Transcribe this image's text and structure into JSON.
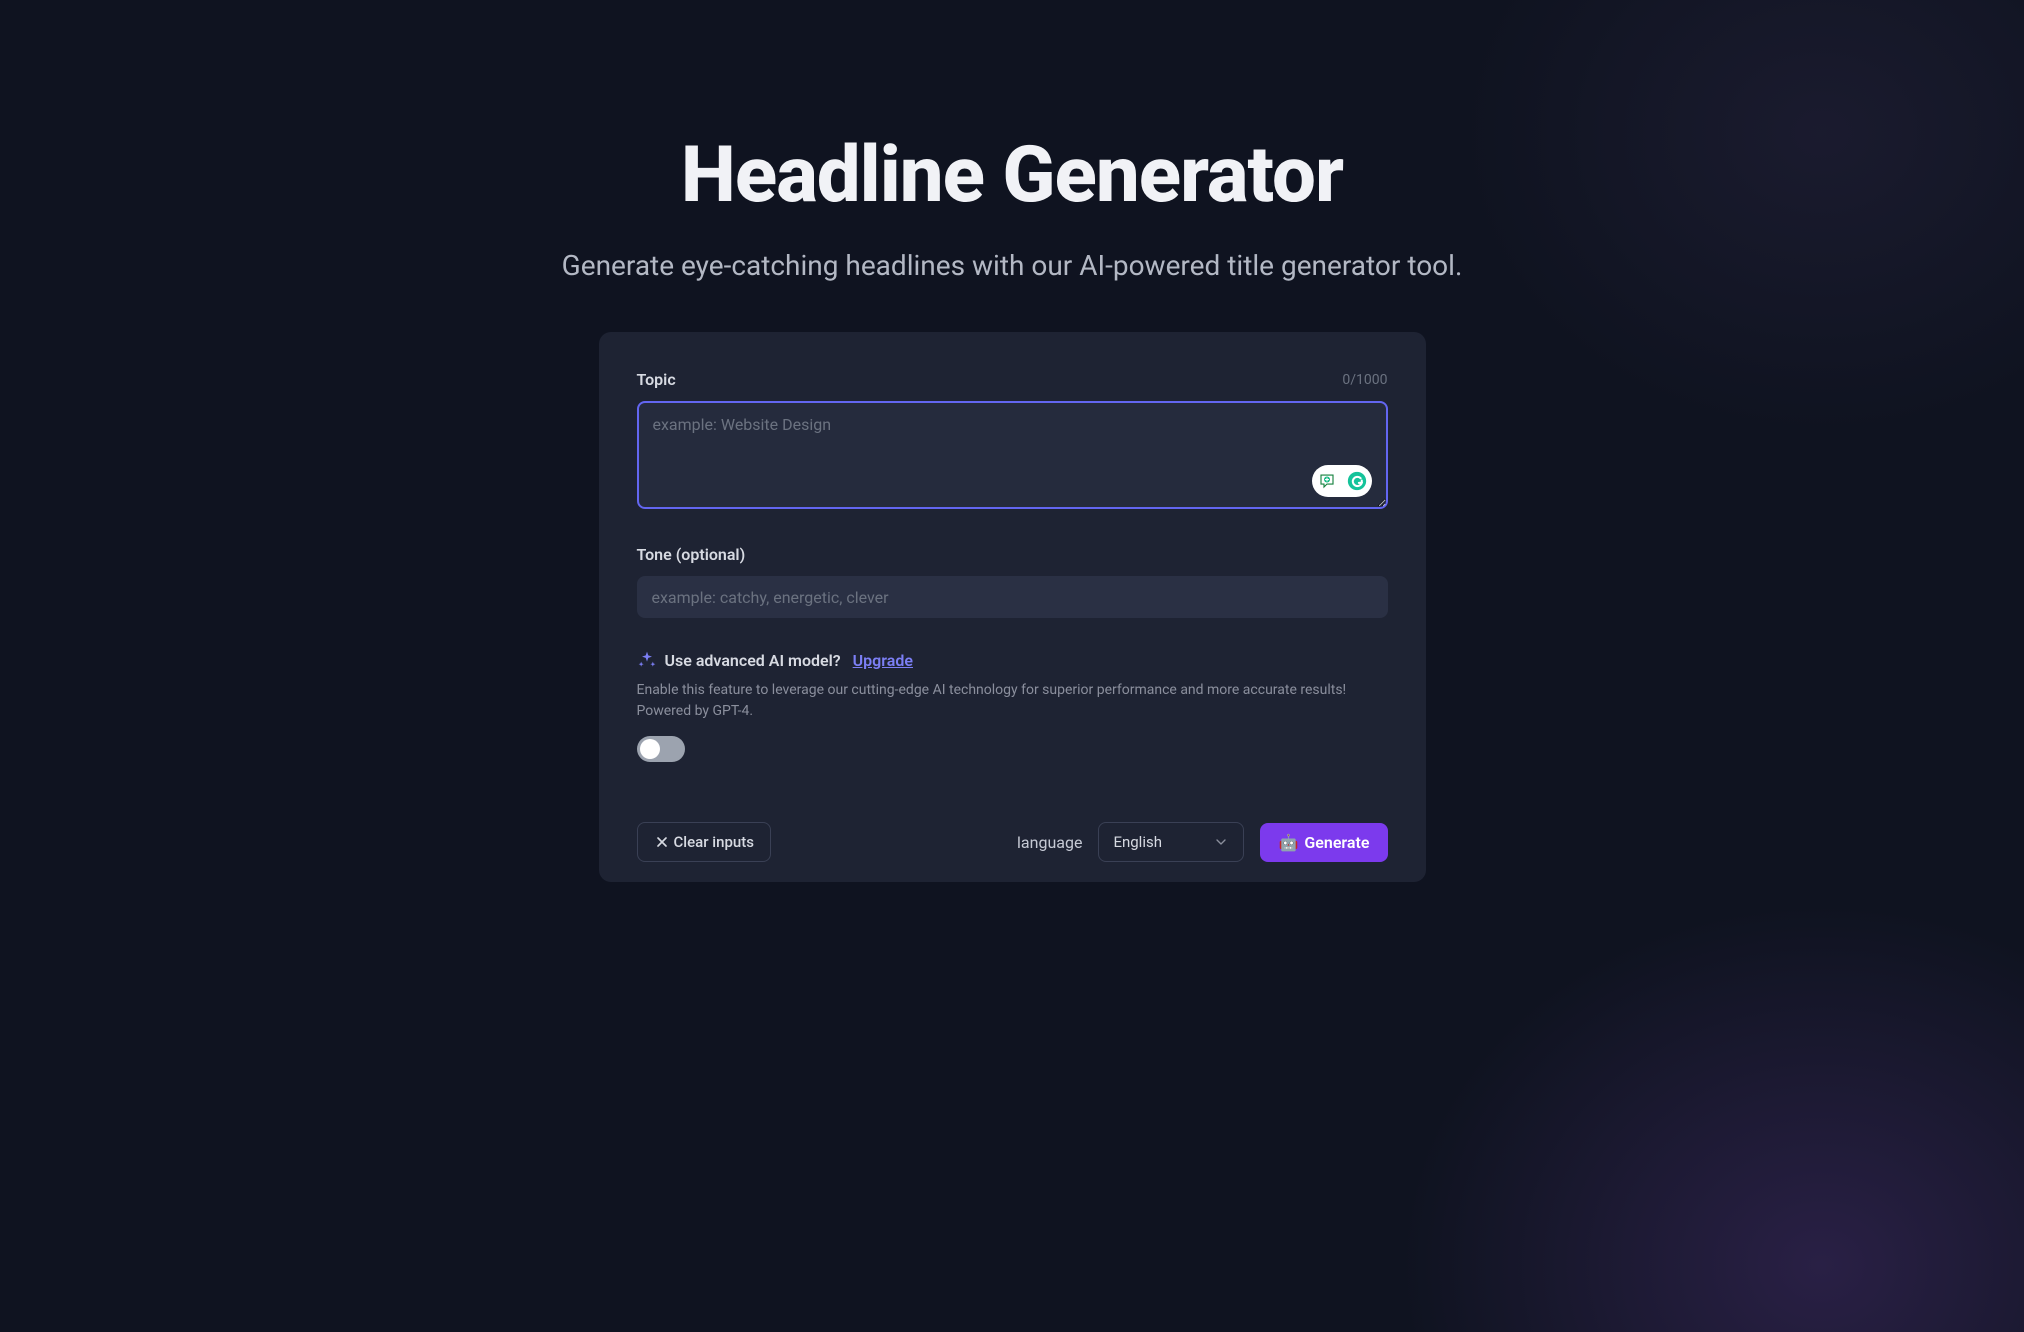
{
  "header": {
    "title": "Headline Generator",
    "subtitle": "Generate eye-catching headlines with our AI-powered title generator tool."
  },
  "form": {
    "topic": {
      "label": "Topic",
      "placeholder": "example: Website Design",
      "value": "",
      "char_count": "0/1000"
    },
    "tone": {
      "label": "Tone (optional)",
      "placeholder": "example: catchy, energetic, clever",
      "value": ""
    },
    "advanced": {
      "label": "Use advanced AI model?",
      "upgrade_text": "Upgrade",
      "description": "Enable this feature to leverage our cutting-edge AI technology for superior performance and more accurate results! Powered by GPT-4.",
      "enabled": false
    }
  },
  "footer": {
    "clear_label": "Clear inputs",
    "language_label": "language",
    "language_selected": "English",
    "generate_label": "Generate",
    "generate_icon": "🤖"
  }
}
